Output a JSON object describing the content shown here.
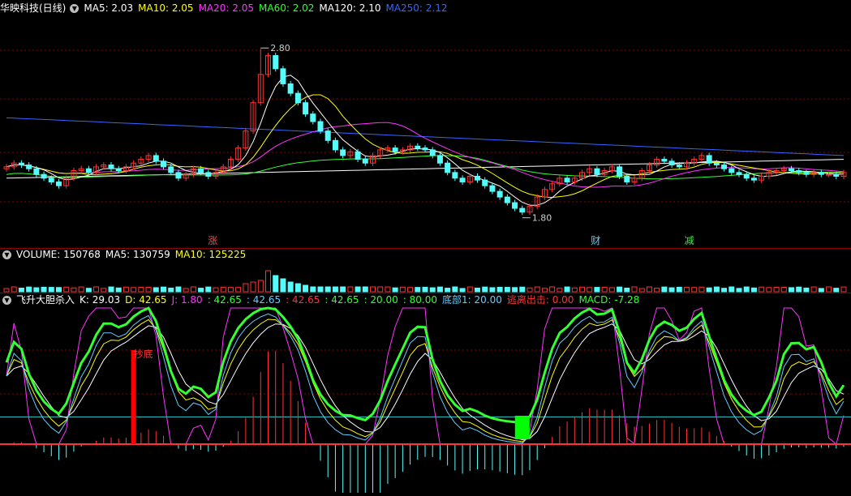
{
  "main_panel": {
    "title": "华映科技(日线)",
    "ma": [
      {
        "label": "MA5: 2.03",
        "color": "#ffffff"
      },
      {
        "label": "MA10: 2.05",
        "color": "#ffff00"
      },
      {
        "label": "MA20: 2.05",
        "color": "#ff33ff"
      },
      {
        "label": "MA60: 2.02",
        "color": "#33ff33"
      },
      {
        "label": "MA120: 2.10",
        "color": "#ffffff"
      },
      {
        "label": "MA250: 2.12",
        "color": "#3366ff"
      }
    ],
    "high_label": "2.80",
    "low_label": "1.80",
    "markers": [
      {
        "text": "涨",
        "color": "#ff4444"
      },
      {
        "text": "财",
        "color": "#66ccff"
      },
      {
        "text": "减",
        "color": "#44ee44"
      }
    ]
  },
  "volume_panel": {
    "labels": [
      {
        "text": "VOLUME: 150768",
        "color": "#ffffff"
      },
      {
        "text": "MA5: 130759",
        "color": "#ffffff"
      },
      {
        "text": "MA10: 125225",
        "color": "#ffff00"
      }
    ]
  },
  "indicator_panel": {
    "labels": [
      {
        "text": "飞升大胆杀入",
        "color": "#ffffff"
      },
      {
        "text": "K: 29.03",
        "color": "#ffffff"
      },
      {
        "text": "D: 42.65",
        "color": "#ffff00"
      },
      {
        "text": "J: 1.80",
        "color": "#ff33ff"
      },
      {
        "text": ": 42.65",
        "color": "#33ff33"
      },
      {
        "text": ": 42.65",
        "color": "#66ccff"
      },
      {
        "text": ": 42.65",
        "color": "#ff3333"
      },
      {
        "text": ": 42.65",
        "color": "#33ff33"
      },
      {
        "text": ": 20.00",
        "color": "#33ff33"
      },
      {
        "text": ": 80.00",
        "color": "#33ff33"
      },
      {
        "text": "底部1: 20.00",
        "color": "#66ccff"
      },
      {
        "text": "逃离出击: 0.00",
        "color": "#ff3333"
      },
      {
        "text": "MACD: -7.28",
        "color": "#33ff33"
      }
    ],
    "signal_label": "抄底"
  },
  "colors": {
    "up": "#ff3333",
    "down": "#54fcfc",
    "ma5": "#ffffff",
    "ma10": "#ffff00",
    "ma20": "#ff33ff",
    "ma60": "#33ff33",
    "ma120": "#ffffff",
    "ma250": "#3366ff",
    "grid": "#8b0000"
  },
  "chart_data": {
    "type": "candlestick",
    "title": "华映科技(日线)",
    "price_high": 2.8,
    "price_low": 1.8,
    "ma_latest": {
      "MA5": 2.03,
      "MA10": 2.05,
      "MA20": 2.05,
      "MA60": 2.02,
      "MA120": 2.1,
      "MA250": 2.12
    },
    "close": [
      2.06,
      2.08,
      2.07,
      2.05,
      2.02,
      2.0,
      1.98,
      1.96,
      2.0,
      2.04,
      2.05,
      2.03,
      2.06,
      2.07,
      2.05,
      2.04,
      2.06,
      2.08,
      2.1,
      2.12,
      2.09,
      2.06,
      2.03,
      2.0,
      2.02,
      2.05,
      2.03,
      2.01,
      2.03,
      2.06,
      2.1,
      2.16,
      2.25,
      2.4,
      2.55,
      2.65,
      2.58,
      2.5,
      2.45,
      2.4,
      2.34,
      2.3,
      2.25,
      2.2,
      2.15,
      2.12,
      2.14,
      2.1,
      2.08,
      2.12,
      2.15,
      2.16,
      2.14,
      2.15,
      2.17,
      2.16,
      2.15,
      2.12,
      2.08,
      2.03,
      2.0,
      1.98,
      2.01,
      1.99,
      1.96,
      1.93,
      1.9,
      1.87,
      1.84,
      1.82,
      1.85,
      1.9,
      1.94,
      1.97,
      2.0,
      1.98,
      2.0,
      2.03,
      2.05,
      2.02,
      2.04,
      2.06,
      2.01,
      1.98,
      2.0,
      2.04,
      2.07,
      2.1,
      2.09,
      2.07,
      2.06,
      2.08,
      2.1,
      2.12,
      2.08,
      2.07,
      2.05,
      2.03,
      2.02,
      2.0,
      1.99,
      2.01,
      2.03,
      2.04,
      2.05,
      2.04,
      2.03,
      2.02,
      2.03,
      2.02,
      2.02,
      2.01,
      2.03
    ]
  }
}
